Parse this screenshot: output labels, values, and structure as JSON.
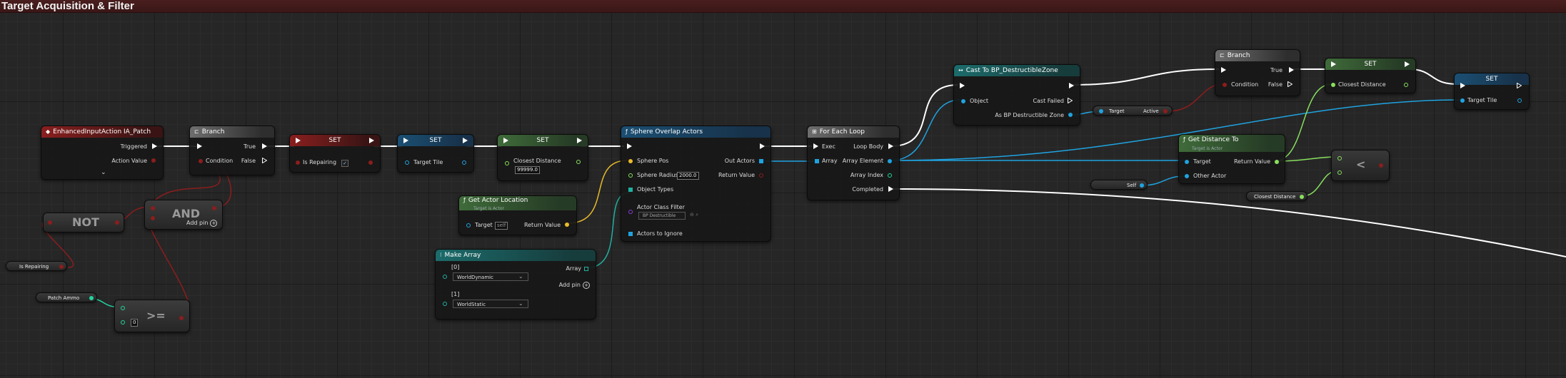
{
  "graph_title": "Target Acquisition & Filter",
  "colors": {
    "exec": "#ffffff",
    "bool": "#8c1d1d",
    "object": "#1fa3e0",
    "float": "#88e05e",
    "vector": "#e8bb2a",
    "int": "#21d6a0",
    "array_gray": "#bbbbbb"
  },
  "nodes": {
    "enhanced_input": {
      "title": "EnhancedInputAction IA_Patch",
      "icon": "event-icon",
      "triggered": "Triggered",
      "action_value": "Action Value"
    },
    "branch1": {
      "title": "Branch",
      "icon": "branch-icon",
      "condition": "Condition",
      "true_label": "True",
      "false_label": "False"
    },
    "set_repairing": {
      "title": "SET",
      "var": "Is Repairing",
      "checked": true
    },
    "set_target_tile1": {
      "title": "SET",
      "var": "Target Tile"
    },
    "set_closest1": {
      "title": "SET",
      "var": "Closest Distance",
      "value": "99999.0"
    },
    "sphere_overlap": {
      "title": "Sphere Overlap Actors",
      "icon": "function-icon",
      "sphere_pos": "Sphere Pos",
      "sphere_radius": "Sphere Radius",
      "radius_value": "2000.0",
      "object_types": "Object Types",
      "actor_class_filter": "Actor Class Filter",
      "filter_value": "BP Destructible",
      "actors_to_ignore": "Actors to Ignore",
      "out_actors": "Out Actors",
      "return_value": "Return Value"
    },
    "get_actor_location": {
      "title": "Get Actor Location",
      "subtitle": "Target is Actor",
      "target": "Target",
      "target_value": "self",
      "return_value": "Return Value"
    },
    "make_array": {
      "title": "Make Array",
      "item0": "[0]",
      "item0_value": "WorldDynamic",
      "item1": "[1]",
      "item1_value": "WorldStatic",
      "array": "Array",
      "add_pin": "Add pin"
    },
    "for_each": {
      "title": "For Each Loop",
      "exec": "Exec",
      "array": "Array",
      "loop_body": "Loop Body",
      "array_element": "Array Element",
      "array_index": "Array Index",
      "completed": "Completed"
    },
    "cast": {
      "title": "Cast To BP_DestructibleZone",
      "object": "Object",
      "cast_failed": "Cast Failed",
      "as_zone": "As BP Destructible Zone"
    },
    "target_active": {
      "target": "Target",
      "active": "Active"
    },
    "branch2": {
      "title": "Branch",
      "condition": "Condition",
      "true_label": "True",
      "false_label": "False"
    },
    "set_closest2": {
      "title": "SET",
      "var": "Closest Distance"
    },
    "set_target_tile2": {
      "title": "SET",
      "var": "Target Tile"
    },
    "get_distance": {
      "title": "Get Distance To",
      "subtitle": "Target is Actor",
      "target": "Target",
      "other_actor": "Other Actor",
      "return_value": "Return Value"
    },
    "less": {
      "op": "<"
    },
    "self_node": {
      "label": "Self"
    },
    "closest_getter": {
      "label": "Closest Distance"
    },
    "not_node": {
      "label": "NOT"
    },
    "and_node": {
      "label": "AND",
      "add_pin": "Add pin"
    },
    "is_repairing_getter": {
      "label": "Is Repairing"
    },
    "patch_ammo_getter": {
      "label": "Patch Ammo"
    },
    "gte_node": {
      "op": ">=",
      "value": "0"
    }
  }
}
